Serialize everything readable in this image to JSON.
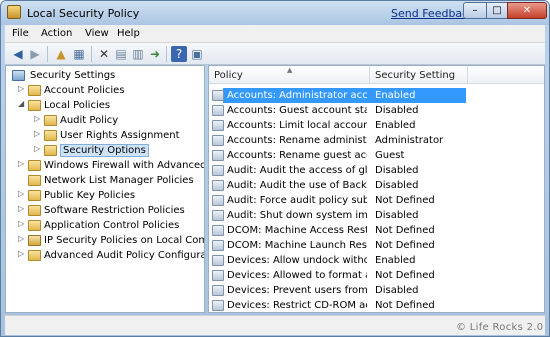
{
  "window": {
    "title": "Local Security Policy",
    "send_feedback": "Send Feedback",
    "minimize_glyph": "–",
    "maximize_glyph": "□",
    "close_glyph": "✕"
  },
  "menu": [
    "File",
    "Action",
    "View",
    "Help"
  ],
  "toolbar_icons": [
    "back-arrow-icon",
    "forward-arrow-icon",
    "up-folder-icon",
    "show-hide-tree-icon",
    "delete-icon",
    "properties-icon",
    "export-list-icon",
    "help-icon",
    "show-pane-icon"
  ],
  "tree": [
    {
      "label": "Security Settings",
      "icon": "shield"
    },
    {
      "label": "Account Policies",
      "icon": "folder"
    },
    {
      "label": "Local Policies",
      "icon": "folder"
    },
    {
      "label": "Audit Policy",
      "icon": "folder"
    },
    {
      "label": "User Rights Assignment",
      "icon": "folder"
    },
    {
      "label": "Security Options",
      "icon": "folder",
      "selected": true
    },
    {
      "label": "Windows Firewall with Advanced Secu",
      "icon": "folder"
    },
    {
      "label": "Network List Manager Policies",
      "icon": "folder"
    },
    {
      "label": "Public Key Policies",
      "icon": "folder"
    },
    {
      "label": "Software Restriction Policies",
      "icon": "folder"
    },
    {
      "label": "Application Control Policies",
      "icon": "folder"
    },
    {
      "label": "IP Security Policies on Local Compute",
      "icon": "lock"
    },
    {
      "label": "Advanced Audit Policy Configuration",
      "icon": "folder"
    }
  ],
  "table": {
    "columns": [
      "Policy",
      "Security Setting"
    ],
    "rows": [
      {
        "policy": "Accounts: Administrator accou...",
        "setting": "Enabled",
        "selected": true
      },
      {
        "policy": "Accounts: Guest account status",
        "setting": "Disabled"
      },
      {
        "policy": "Accounts: Limit local account u...",
        "setting": "Enabled"
      },
      {
        "policy": "Accounts: Rename administrat...",
        "setting": "Administrator"
      },
      {
        "policy": "Accounts: Rename guest accou...",
        "setting": "Guest"
      },
      {
        "policy": "Audit: Audit the access of glob...",
        "setting": "Disabled"
      },
      {
        "policy": "Audit: Audit the use of Backup ...",
        "setting": "Disabled"
      },
      {
        "policy": "Audit: Force audit policy subcat...",
        "setting": "Not Defined"
      },
      {
        "policy": "Audit: Shut down system imme...",
        "setting": "Disabled"
      },
      {
        "policy": "DCOM: Machine Access Restric...",
        "setting": "Not Defined"
      },
      {
        "policy": "DCOM: Machine Launch Restri...",
        "setting": "Not Defined"
      },
      {
        "policy": "Devices: Allow undock without ...",
        "setting": "Enabled"
      },
      {
        "policy": "Devices: Allowed to format and...",
        "setting": "Not Defined"
      },
      {
        "policy": "Devices: Prevent users from inst...",
        "setting": "Disabled"
      },
      {
        "policy": "Devices: Restrict CD-ROM acce...",
        "setting": "Not Defined"
      }
    ]
  },
  "watermark": "© Life Rocks 2.0",
  "colors": {
    "selection": "#3399ff",
    "link": "#0b2f8a",
    "tree_selection": "#cfe3f7"
  }
}
